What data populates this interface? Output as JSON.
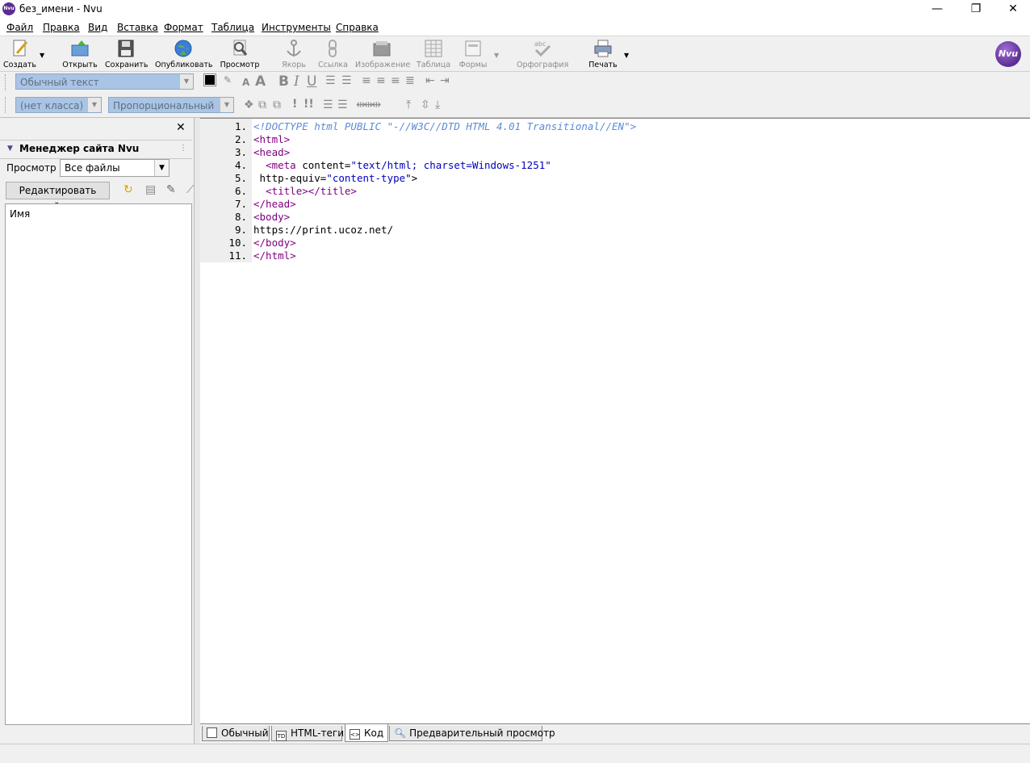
{
  "window": {
    "title": "без_имени - Nvu",
    "app_icon": "Nvu"
  },
  "menu": [
    "Файл",
    "Правка",
    "Вид",
    "Вставка",
    "Формат",
    "Таблица",
    "Инструменты",
    "Справка"
  ],
  "toolbar": {
    "create": "Создать",
    "open": "Открыть",
    "save": "Сохранить",
    "publish": "Опубликовать",
    "preview": "Просмотр",
    "anchor": "Якорь",
    "link": "Ссылка",
    "image": "Изображение",
    "table": "Таблица",
    "forms": "Формы",
    "spelling": "Орфография",
    "print": "Печать",
    "logo": "Nvu"
  },
  "format": {
    "paragraph_style": "Обычный текст",
    "class": "(нет класса)",
    "font": "Пропорциональный",
    "bold": "B",
    "italic": "I",
    "underline": "U",
    "excl1": "!",
    "excl2": "!!"
  },
  "site_manager": {
    "title": "Менеджер сайта Nvu",
    "view_label": "Просмотр",
    "view_value": "Все файлы",
    "edit_sites": "Редактировать сайты",
    "column_name": "Имя"
  },
  "code": [
    {
      "n": "1.",
      "parts": [
        [
          "doctype",
          "<!DOCTYPE html PUBLIC \"-//W3C//DTD HTML 4.01 Transitional//EN\">"
        ]
      ]
    },
    {
      "n": "2.",
      "parts": [
        [
          "tag",
          "<html>"
        ]
      ]
    },
    {
      "n": "3.",
      "parts": [
        [
          "tag",
          "<head>"
        ]
      ]
    },
    {
      "n": "4.",
      "parts": [
        [
          "plain",
          "  "
        ],
        [
          "tag",
          "<meta"
        ],
        [
          "attr",
          " content="
        ],
        [
          "val",
          "\"text/html; charset=Windows-1251\""
        ]
      ]
    },
    {
      "n": "5.",
      "parts": [
        [
          "attr",
          " http-equiv="
        ],
        [
          "val",
          "\"content-type"
        ],
        [
          "attr",
          "\">"
        ]
      ]
    },
    {
      "n": "6.",
      "parts": [
        [
          "plain",
          "  "
        ],
        [
          "tag",
          "<title></title>"
        ]
      ]
    },
    {
      "n": "7.",
      "parts": [
        [
          "tag",
          "</head>"
        ]
      ]
    },
    {
      "n": "8.",
      "parts": [
        [
          "tag",
          "<body>"
        ]
      ]
    },
    {
      "n": "9.",
      "parts": [
        [
          "plain",
          "https://print.ucoz.net/"
        ]
      ]
    },
    {
      "n": "10.",
      "parts": [
        [
          "tag",
          "</body>"
        ]
      ]
    },
    {
      "n": "11.",
      "parts": [
        [
          "tag",
          "</html>"
        ]
      ]
    }
  ],
  "tabs": {
    "normal": "Обычный",
    "html_tags": "HTML-теги",
    "source": "Код",
    "preview": "Предварительный просмотр",
    "td_icon": "TD"
  },
  "colors": {
    "tag": "#800080",
    "value": "#0000c0",
    "doctype": "#5a8cd6",
    "accent": "#5b2d91"
  }
}
